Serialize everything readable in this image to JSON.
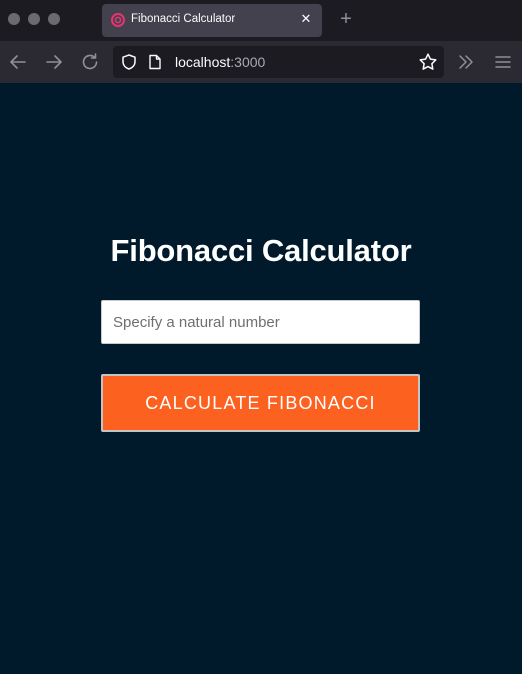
{
  "browser": {
    "tab": {
      "title": "Fibonacci Calculator",
      "close_glyph": "✕",
      "favicon": "record-circle-icon"
    },
    "new_tab_glyph": "+",
    "url": {
      "host": "localhost",
      "port": ":3000"
    },
    "icons": [
      "back-arrow-icon",
      "forward-arrow-icon",
      "reload-icon",
      "shield-icon",
      "page-icon",
      "star-icon",
      "chevrons-right-icon",
      "hamburger-menu-icon"
    ]
  },
  "page": {
    "title": "Fibonacci Calculator",
    "input": {
      "value": "",
      "placeholder": "Specify a natural number"
    },
    "button_label": "CALCULATE FIBONACCI"
  },
  "colors": {
    "page_background": "#001a2c",
    "button": "#fd6120",
    "favicon": "#e8336f"
  }
}
